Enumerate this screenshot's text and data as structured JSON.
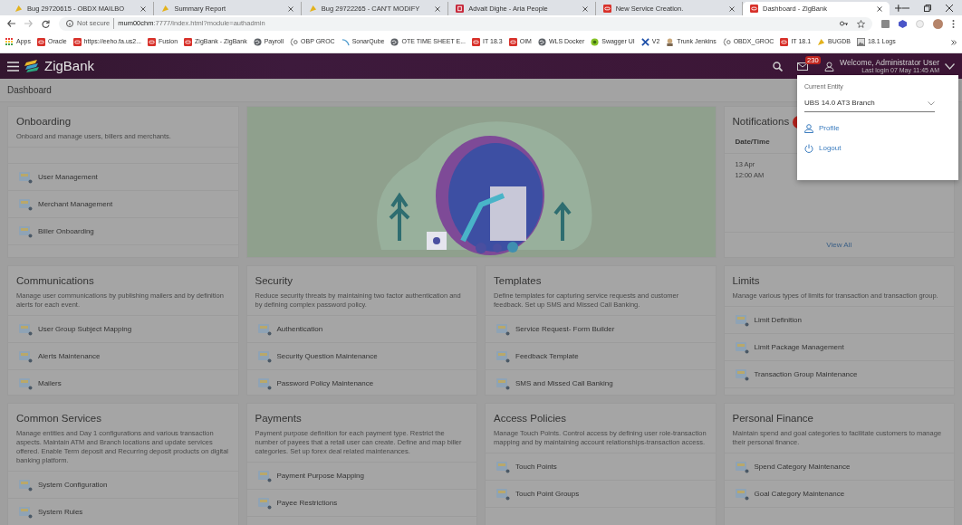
{
  "browser": {
    "tabs": [
      {
        "title": "Bug 29720615 - OBDX MAILBO",
        "kind": "bug",
        "selected": false
      },
      {
        "title": "Summary Report",
        "kind": "bug",
        "selected": false
      },
      {
        "title": "Bug 29722265 - CAN'T MODIFY",
        "kind": "bug",
        "selected": false
      },
      {
        "title": "Advait Dighe - Aria People",
        "kind": "aria",
        "selected": false
      },
      {
        "title": "New Service Creation.",
        "kind": "oracle",
        "selected": false
      },
      {
        "title": "Dashboard - ZigBank",
        "kind": "oracle",
        "selected": true
      }
    ],
    "address": {
      "security": "Not secure",
      "host": "mum00chm",
      "rest": ":7777/index.html?module=authadmin"
    },
    "bookmarks": [
      {
        "label": "Apps",
        "kind": "grid"
      },
      {
        "label": "Oracle",
        "kind": "oracle"
      },
      {
        "label": "https://eeho.fa.us2...",
        "kind": "oracle"
      },
      {
        "label": "Fusion",
        "kind": "oracle"
      },
      {
        "label": "ZigBank - ZigBank",
        "kind": "oracle"
      },
      {
        "label": "Payroll",
        "kind": "globe"
      },
      {
        "label": "OBP GROC",
        "kind": "braces"
      },
      {
        "label": "SonarQube",
        "kind": "sonar"
      },
      {
        "label": "OTE TIME SHEET E...",
        "kind": "globe"
      },
      {
        "label": "IT 18.3",
        "kind": "oracle"
      },
      {
        "label": "OIM",
        "kind": "oracle"
      },
      {
        "label": "WLS Docker",
        "kind": "globe"
      },
      {
        "label": "Swagger UI",
        "kind": "swagger"
      },
      {
        "label": "V2",
        "kind": "cross"
      },
      {
        "label": "Trunk Jenkins",
        "kind": "person"
      },
      {
        "label": "OBDX_GROC",
        "kind": "braces"
      },
      {
        "label": "IT 18.1",
        "kind": "oracle"
      },
      {
        "label": "BUGDB",
        "kind": "bug"
      },
      {
        "label": "18.1 Logs",
        "kind": "image"
      }
    ]
  },
  "header": {
    "brand": "ZigBank",
    "mail_count": "230",
    "welcome": "Welcome, Administrator User",
    "last_login": "Last login 07 May 11:45 AM"
  },
  "page_title": "Dashboard",
  "cards": [
    {
      "kind": "links",
      "title": "Onboarding",
      "description": "Onboard and manage users, billers and merchants.",
      "items": [
        "User Management",
        "Merchant Management",
        "Biller Onboarding"
      ]
    },
    {
      "kind": "illustration"
    },
    {
      "kind": "notifications",
      "title": "Notifications",
      "column": "Date/Time",
      "date": "13 Apr",
      "time": "12:00 AM",
      "view_all": "View All"
    },
    {
      "kind": "links",
      "title": "Communications",
      "description": "Manage user communications by publishing mailers and by definition alerts for each event.",
      "items": [
        "User Group Subject Mapping",
        "Alerts Maintenance",
        "Mailers"
      ]
    },
    {
      "kind": "links",
      "title": "Security",
      "description": "Reduce security threats by maintaining two factor authentication and by defining complex password policy.",
      "items": [
        "Authentication",
        "Security Question Maintenance",
        "Password Policy Maintenance"
      ]
    },
    {
      "kind": "links",
      "title": "Templates",
      "description": "Define templates for capturing service requests and customer feedback. Set up SMS and Missed Call Banking.",
      "items": [
        "Service Request- Form Builder",
        "Feedback Template",
        "SMS and Missed Call Banking"
      ]
    },
    {
      "kind": "links",
      "title": "Limits",
      "description": "Manage various types of limits for transaction and transaction group.",
      "items": [
        "Limit Definition",
        "Limit Package Management",
        "Transaction Group Maintenance"
      ]
    },
    {
      "kind": "links",
      "title": "Common Services",
      "description": "Manage entities and Day 1 configurations and various transaction aspects. Maintain ATM and Branch locations and update services offered. Enable Term deposit and Recurring deposit products on digital banking platform.",
      "items": [
        "System Configuration",
        "System Rules"
      ]
    },
    {
      "kind": "links",
      "title": "Payments",
      "description": "Payment purpose definition for each payment type. Restrict the number of payees that a retail user can create. Define and map biller categories. Set up forex deal related maintenances.",
      "items": [
        "Payment Purpose Mapping",
        "Payee Restrictions"
      ]
    },
    {
      "kind": "links",
      "title": "Access Policies",
      "description": "Manage Touch Points. Control access by defining user role-transaction mapping and by maintaining account relationships-transaction access.",
      "items": [
        "Touch Points",
        "Touch Point Groups"
      ]
    },
    {
      "kind": "links",
      "title": "Personal Finance",
      "description": "Maintain spend and goal categories to facilitate customers to manage their personal finance.",
      "items": [
        "Spend Category Maintenance",
        "Goal Category Maintenance"
      ]
    }
  ],
  "menu": {
    "label": "Current Entity",
    "value": "UBS 14.0 AT3 Branch",
    "items": [
      {
        "label": "Profile",
        "kind": "profile"
      },
      {
        "label": "Logout",
        "kind": "logout"
      }
    ]
  }
}
